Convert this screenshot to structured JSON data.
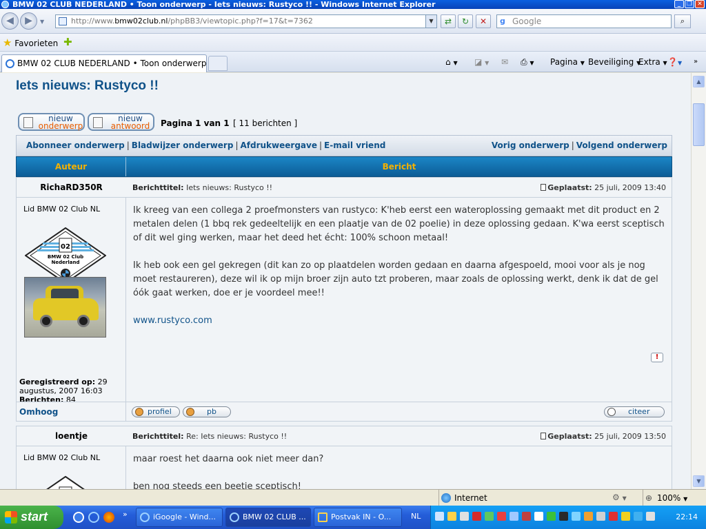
{
  "window": {
    "title": "BMW 02 CLUB NEDERLAND • Toon onderwerp - Iets nieuws: Rustyco !! - Windows Internet Explorer"
  },
  "address": {
    "url_prefix": "http://www.",
    "url_host": "bmw02club.nl",
    "url_path": "/phpBB3/viewtopic.php?f=17&t=7362"
  },
  "search": {
    "placeholder": "Google"
  },
  "favorites": {
    "label": "Favorieten"
  },
  "tab": {
    "label": "BMW 02 CLUB NEDERLAND • Toon onderwerp - Iets ..."
  },
  "commands": {
    "pagina": "Pagina",
    "beveiliging": "Beveiliging",
    "extra": "Extra"
  },
  "topic": {
    "title": "Iets nieuws: Rustyco !!",
    "new_topic_l1": "nieuw",
    "new_topic_l2": "onderwerp",
    "new_reply_l1": "nieuw",
    "new_reply_l2": "antwoord",
    "pagination": "Pagina 1 van 1",
    "post_count": "[ 11 berichten ]",
    "links_left": [
      "Abonneer onderwerp",
      "Bladwijzer onderwerp",
      "Afdrukweergave",
      "E-mail vriend"
    ],
    "links_right": [
      "Vorig onderwerp",
      "Volgend onderwerp"
    ]
  },
  "table": {
    "col_author": "Auteur",
    "col_message": "Bericht"
  },
  "posts": [
    {
      "author": "RichaRD350R",
      "subject_label": "Berichttitel:",
      "subject": "Iets nieuws: Rustyco !!",
      "posted_label": "Geplaatst:",
      "posted": "25 juli, 2009 13:40",
      "rank": "Lid BMW 02 Club NL",
      "registered_label": "Geregistreerd op:",
      "registered": "29 augustus, 2007 16:03",
      "messages_label": "Berichten:",
      "messages": "84",
      "body_p1": "Ik kreeg van een collega 2 proefmonsters van rustyco: K'heb eerst een wateroplossing gemaakt met dit product en 2 metalen delen (1 bbq rek gedeeltelijk en een plaatje van de 02 poelie) in deze oplossing gedaan. K'wa eerst sceptisch of dit wel ging werken, maar het deed het écht: 100% schoon metaal!",
      "body_p2": "Ik heb ook een gel gekregen (dit kan zo op plaatdelen worden gedaan en daarna afgespoeld, mooi voor als je nog moet restaureren), deze wil ik op mijn broer zijn auto tzt proberen, maar zoals de oplossing werkt, denk ik dat de gel óók gaat werken, doe er je voordeel mee!!",
      "link": "www.rustyco.com",
      "top_link": "Omhoog",
      "btn_profile": "profiel",
      "btn_pm": "pb",
      "btn_quote": "citeer"
    },
    {
      "author": "loentje",
      "subject_label": "Berichttitel:",
      "subject": "Re: Iets nieuws: Rustyco !!",
      "posted_label": "Geplaatst:",
      "posted": "25 juli, 2009 13:50",
      "rank": "Lid BMW 02 Club NL",
      "body_p1": "maar roest het daarna ook niet meer dan?",
      "body_p2": "ben nog steeds een beetje sceptisch!"
    }
  ],
  "logo_text": {
    "line1": "BMW 02 Club",
    "line2": "Nederland",
    "mark": "02"
  },
  "statusbar": {
    "zone": "Internet",
    "zoom": "100%"
  },
  "taskbar": {
    "start": "start",
    "tasks": [
      "iGoogle - Wind...",
      "BMW 02 CLUB ...",
      "Postvak IN - O..."
    ],
    "lang": "NL",
    "clock": "22:14"
  }
}
